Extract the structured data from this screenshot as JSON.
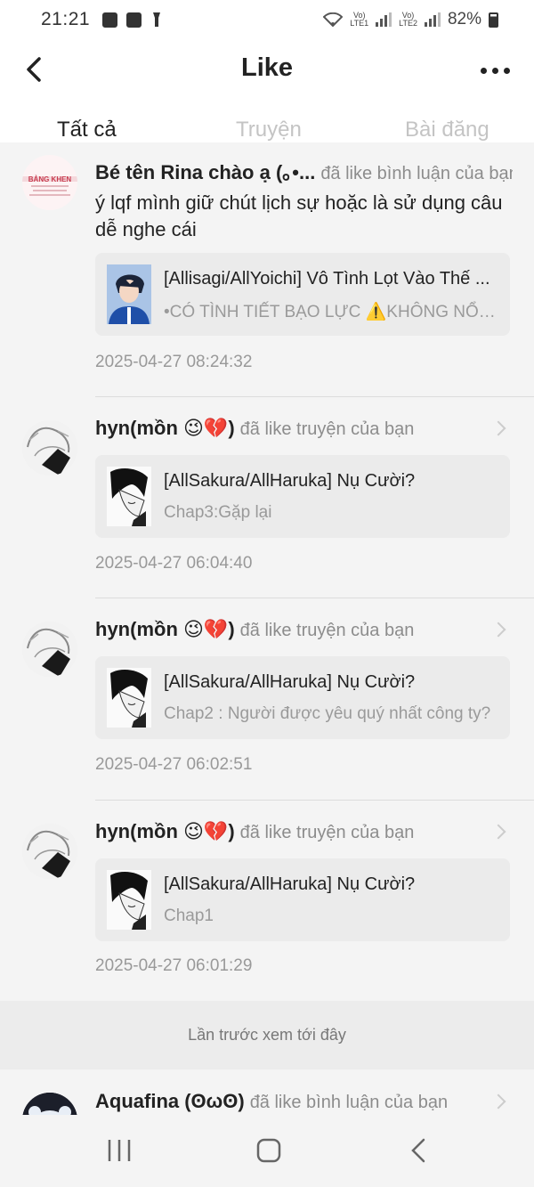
{
  "status_bar": {
    "time": "21:21",
    "battery": "82%",
    "sim1": "VoLTE1",
    "sim2": "VoLTE2"
  },
  "header": {
    "title": "Like",
    "back_icon": "back-arrow-icon",
    "more_icon": "more-dots-icon"
  },
  "tabs": [
    {
      "label": "Tất cả",
      "active": true
    },
    {
      "label": "Truyện",
      "active": false
    },
    {
      "label": "Bài đăng",
      "active": false
    }
  ],
  "colors": {
    "accent": "#f0607c",
    "muted": "#8c8c8c",
    "card_bg": "#ebebeb"
  },
  "feed": [
    {
      "user": "Bé tên Rina chào ạ (｡•...",
      "action": "đã like bình luận của bạn",
      "comment": "ý lqf mình giữ chút lịch sự hoặc là sử dụng câu dễ nghe cái",
      "card_title": "[Allisagi/AllYoichi] Vô Tình Lọt Vào Thế ...",
      "card_sub": "•CÓ TÌNH TIẾT BẠO LỰC ⚠️KHÔNG NỔI ...",
      "time": "2025-04-27 08:24:32"
    },
    {
      "user": "hyn(mồn 😉💔)",
      "action": "đã like truyện của bạn",
      "card_title": "[AllSakura/AllHaruka] Nụ Cười?",
      "card_sub": "Chap3:Gặp lại",
      "time": "2025-04-27 06:04:40"
    },
    {
      "user": "hyn(mồn 😉💔)",
      "action": "đã like truyện của bạn",
      "card_title": "[AllSakura/AllHaruka] Nụ Cười?",
      "card_sub": "Chap2 : Người được yêu quý nhất công ty?",
      "time": "2025-04-27 06:02:51"
    },
    {
      "user": "hyn(mồn 😉💔)",
      "action": "đã like truyện của bạn",
      "card_title": "[AllSakura/AllHaruka] Nụ Cười?",
      "card_sub": "Chap1",
      "time": "2025-04-27 06:01:29"
    },
    {
      "user": "Aquafina (ʘωʘ)",
      "action": "đã like bình luận của bạn"
    }
  ],
  "seen_marker": "Lần trước xem tới đây",
  "nav": {
    "recents_icon": "recents-icon",
    "home_icon": "home-icon",
    "back_icon": "back-icon"
  }
}
